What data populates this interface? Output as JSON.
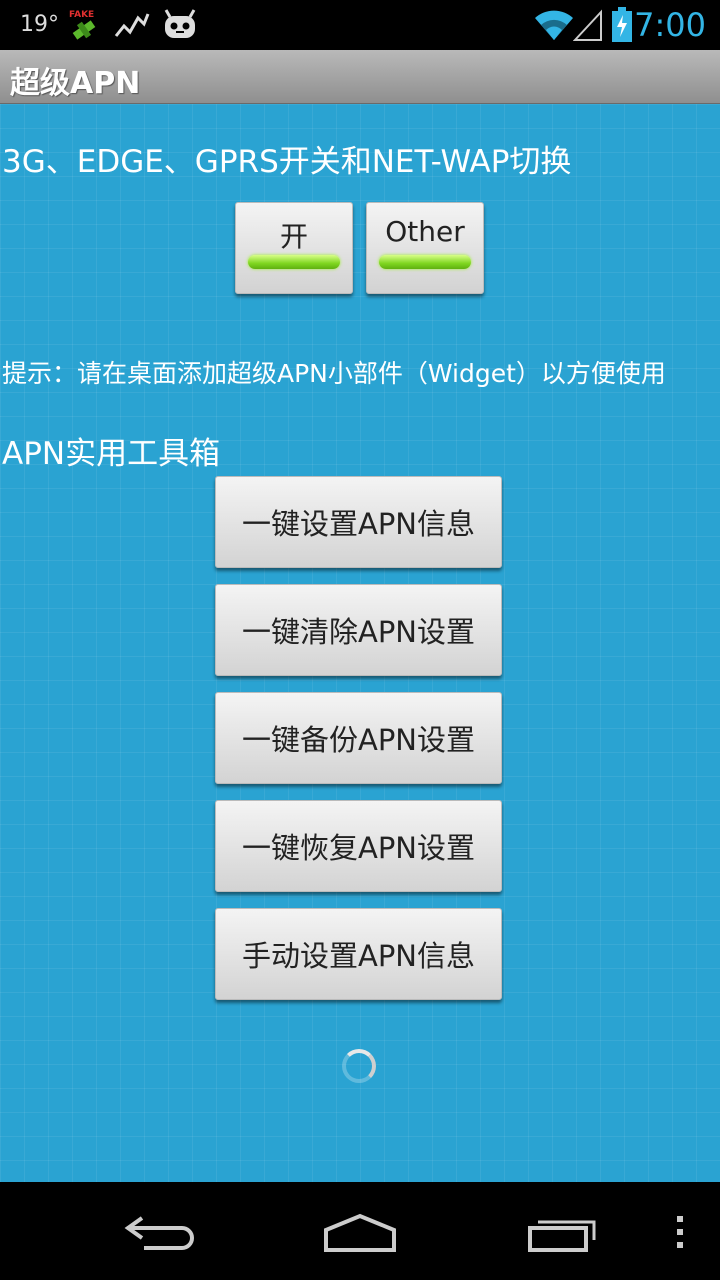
{
  "status_bar": {
    "temperature": "19°",
    "time": "7:00",
    "icons": [
      "fake-gps-icon",
      "activity-graph-icon",
      "android-robot-icon",
      "wifi-icon",
      "cell-signal-icon",
      "battery-charging-icon"
    ]
  },
  "app": {
    "title": "超级APN"
  },
  "switch_section": {
    "heading": "3G、EDGE、GPRS开关和NET-WAP切换",
    "on_button": "开",
    "other_button": "Other"
  },
  "hint": "提示：请在桌面添加超级APN小部件（Widget）以方便使用",
  "toolbox": {
    "heading": "APN实用工具箱",
    "buttons": [
      "一键设置APN信息",
      "一键清除APN设置",
      "一键备份APN设置",
      "一键恢复APN设置",
      "手动设置APN信息"
    ]
  },
  "nav_bar": {
    "icons": [
      "back-icon",
      "home-icon",
      "recent-apps-icon",
      "overflow-menu-icon"
    ]
  },
  "colors": {
    "background": "#2aa3d2",
    "accent": "#33b5e5",
    "indicator": "#7fd620"
  }
}
